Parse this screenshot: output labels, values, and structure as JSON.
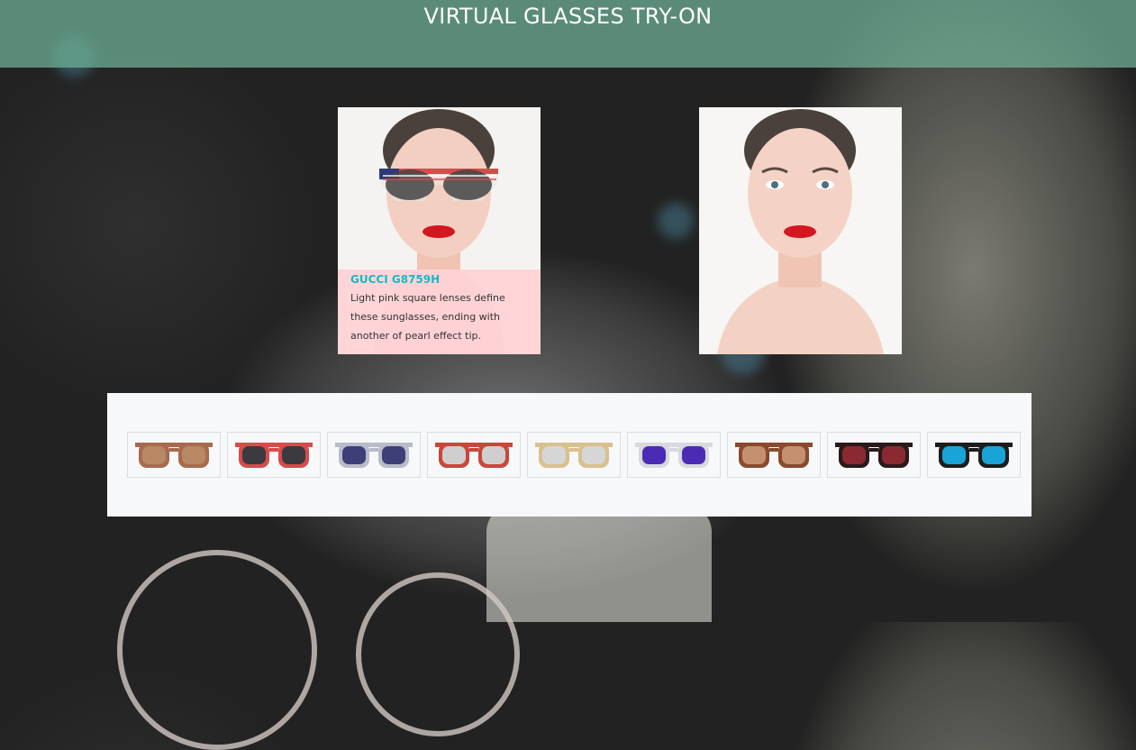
{
  "header": {
    "title": "VIRTUAL GLASSES TRY-ON"
  },
  "preview": {
    "product_name": "GUCCI G8759H",
    "product_description": "Light pink square lenses define these sunglasses, ending with another of pearl effect tip."
  },
  "catalog": {
    "items": [
      {
        "name": "brown-square-sunglasses",
        "frame": "#a86a4e",
        "lens": "#b98864"
      },
      {
        "name": "american-flag-sunglasses",
        "frame": "#d94b4b",
        "lens": "#3a3a40"
      },
      {
        "name": "navy-aviator-sunglasses",
        "frame": "#b8bcc8",
        "lens": "#3f3f78"
      },
      {
        "name": "red-square-sunglasses",
        "frame": "#c9473a",
        "lens": "#cfcfcf"
      },
      {
        "name": "gold-cateye-sunglasses",
        "frame": "#d9c08f",
        "lens": "#d6d6d6"
      },
      {
        "name": "purple-round-sunglasses",
        "frame": "#d8d8de",
        "lens": "#4b2bb5"
      },
      {
        "name": "tortoise-square-sunglasses",
        "frame": "#8a4a2e",
        "lens": "#c49070"
      },
      {
        "name": "black-red-mirror-sunglasses",
        "frame": "#2a1a1a",
        "lens": "#8a2a30"
      },
      {
        "name": "black-blue-mirror-sunglasses",
        "frame": "#1d1d1d",
        "lens": "#1aa3d6"
      }
    ]
  },
  "colors": {
    "accent": "#19b8c8",
    "header": "#6eaf96",
    "caption_bg": "#ffd2d6",
    "tray": "#f7f8fa"
  }
}
